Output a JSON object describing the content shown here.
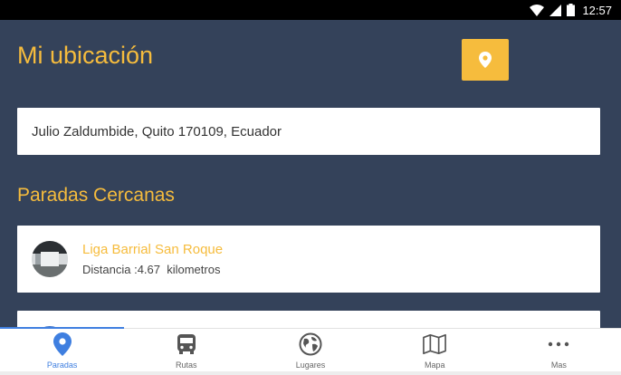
{
  "status_bar": {
    "time": "12:57"
  },
  "header": {
    "title": "Mi ubicación"
  },
  "address": {
    "value": "Julio Zaldumbide, Quito 170109, Ecuador"
  },
  "nearby": {
    "section_title": "Paradas Cercanas",
    "stops": [
      {
        "name": "Liga Barrial San Roque",
        "distance": "Distancia :4.67  kilometros"
      }
    ]
  },
  "tabs": [
    {
      "label": "Paradas",
      "icon": "map-pin-icon",
      "active": true
    },
    {
      "label": "Rutas",
      "icon": "bus-icon",
      "active": false
    },
    {
      "label": "Lugares",
      "icon": "globe-icon",
      "active": false
    },
    {
      "label": "Mapa",
      "icon": "map-icon",
      "active": false
    },
    {
      "label": "Mas",
      "icon": "more-icon",
      "active": false
    }
  ],
  "colors": {
    "background": "#34425a",
    "accent": "#f6bc3d",
    "tab_active": "#3f7fe0"
  }
}
